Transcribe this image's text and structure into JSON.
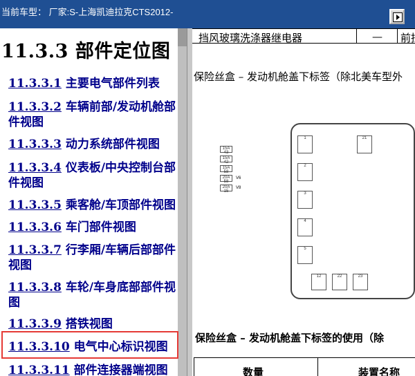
{
  "window": {
    "title": "当前车型： 厂家:S-上海凯迪拉克CTS2012-",
    "nav_icon": "go-forward-icon"
  },
  "left_panel": {
    "section_title": "11.3.3 部件定位图",
    "toc_items": [
      {
        "num": "11.3.3.1",
        "label": "主要电气部件列表"
      },
      {
        "num": "11.3.3.2",
        "label": "车辆前部/发动机舱部件视图"
      },
      {
        "num": "11.3.3.3",
        "label": "动力系统部件视图"
      },
      {
        "num": "11.3.3.4",
        "label": "仪表板/中央控制台部件视图"
      },
      {
        "num": "11.3.3.5",
        "label": "乘客舱/车顶部件视图"
      },
      {
        "num": "11.3.3.6",
        "label": "车门部件视图"
      },
      {
        "num": "11.3.3.7",
        "label": "行李厢/车辆后部部件视图"
      },
      {
        "num": "11.3.3.8",
        "label": "车轮/车身底部部件视图"
      },
      {
        "num": "11.3.3.9",
        "label": "搭铁视图"
      },
      {
        "num": "11.3.3.10",
        "label": "电气中心标识视图"
      },
      {
        "num": "11.3.3.11",
        "label": "部件连接器端视图"
      }
    ],
    "selected_item": "11.3.3.10",
    "highlight_color": "#e53935"
  },
  "right_panel": {
    "table_row": {
      "name": "挡风玻璃洗涤器继电器",
      "dash": "—",
      "location": "前挡"
    },
    "caption_top": "保险丝盒 – 发动机舱盖下标签（除北美车型外",
    "fuse_labels": [
      "15A 43",
      "15A 42",
      "15A 58",
      "20A 58",
      "20A 15"
    ],
    "indicator_labels": [
      "V6",
      "V8"
    ],
    "diagram_numbers": [
      "1",
      "2",
      "3",
      "4",
      "5",
      "21",
      "12",
      "22",
      "23"
    ],
    "caption_bottom": "保险丝盒 – 发动机舱盖下标签的使用（除",
    "table2_headers": [
      "数量",
      "装置名称"
    ]
  },
  "colors": {
    "titlebar_bg": "#1f4f93",
    "link_color": "#00008b"
  }
}
